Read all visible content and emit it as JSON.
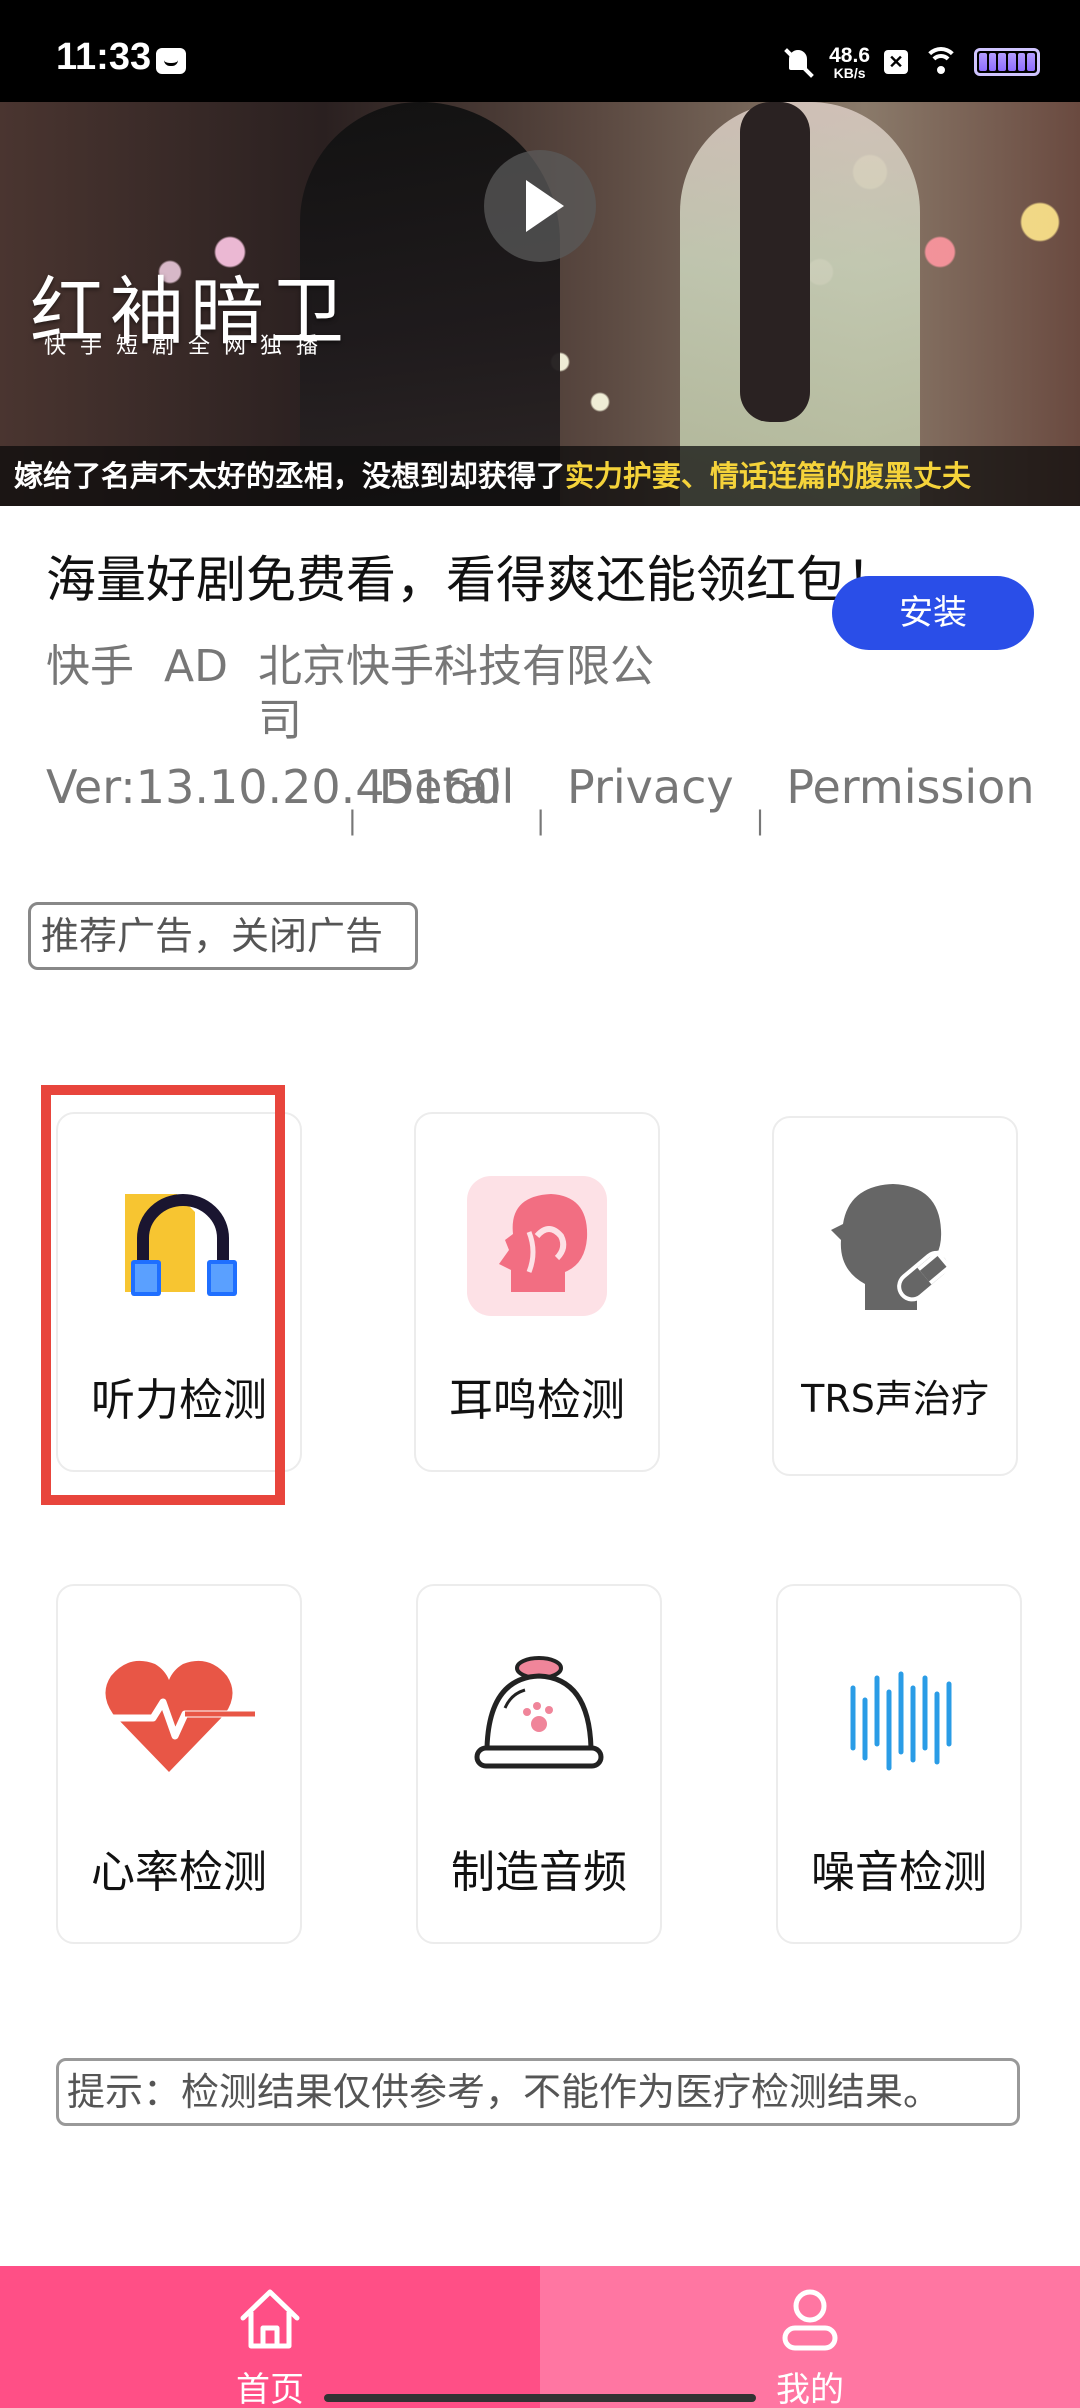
{
  "status_bar": {
    "time": "11:33",
    "net_speed_value": "48.6",
    "net_speed_unit": "KB/s"
  },
  "ad": {
    "drama_title": "红袖暗卫",
    "drama_subtitle": "快手短剧全网独播",
    "caption_part1": "嫁给了名声不太好的丞相，没想到却获得了",
    "caption_part2": "实力护妻、情话连篇的腹黑丈夫",
    "headline": "海量好剧免费看，看得爽还能领红包！",
    "install_label": "安装",
    "app_name": "快手",
    "ad_tag": "AD",
    "company": "北京快手科技有限公司",
    "version": "Ver:13.10.20.45160",
    "detail_link": "Detail",
    "privacy_link": "Privacy",
    "permission_link": "Permission",
    "separator": "|",
    "close_label": "推荐广告，关闭广告"
  },
  "features": [
    {
      "label": "听力检测",
      "icon": "hearing-test-icon"
    },
    {
      "label": "耳鸣检测",
      "icon": "tinnitus-icon"
    },
    {
      "label": "TRS声治疗",
      "icon": "sound-therapy-icon"
    },
    {
      "label": "心率检测",
      "icon": "heart-rate-icon"
    },
    {
      "label": "制造音频",
      "icon": "cloche-icon"
    },
    {
      "label": "噪音检测",
      "icon": "sound-wave-icon"
    }
  ],
  "notice": "提示：检测结果仅供参考，不能作为医疗检测结果。",
  "nav": {
    "home_label": "首页",
    "mine_label": "我的"
  },
  "colors": {
    "install_button": "#2a4ee8",
    "highlight_box": "#e8453c",
    "nav_home_bg": "#ff4f86",
    "nav_mine_bg": "#ff76a2"
  }
}
